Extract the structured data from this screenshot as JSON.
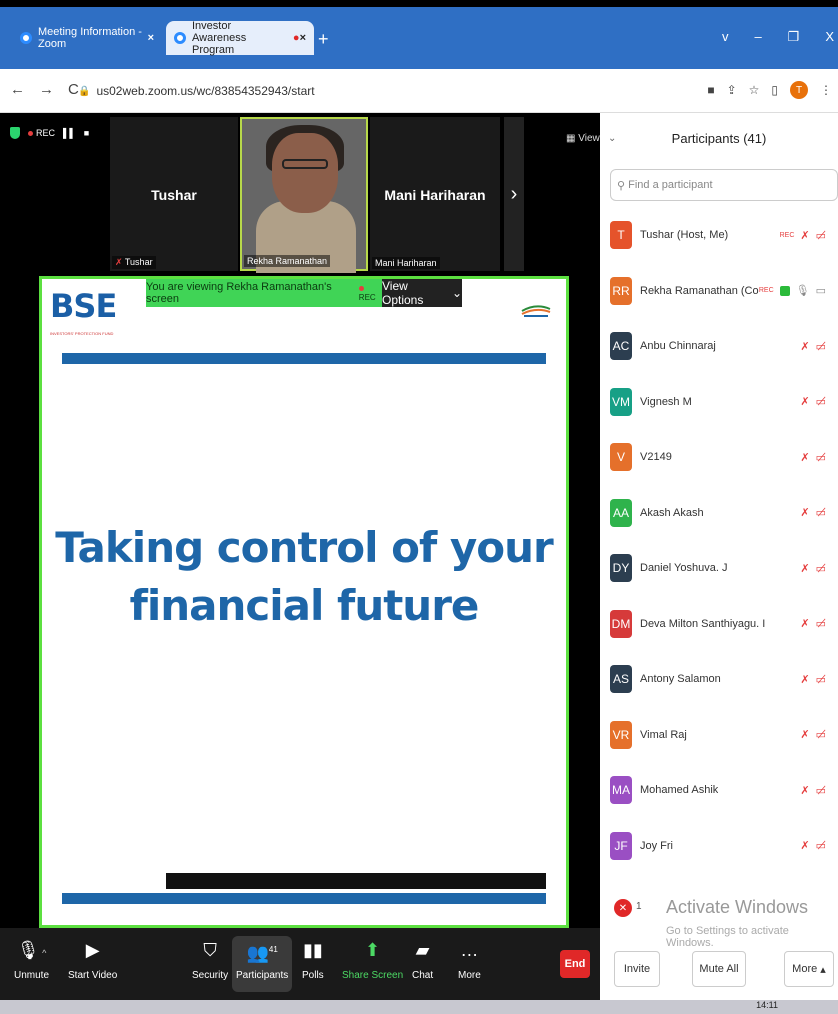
{
  "browser": {
    "tabs": [
      {
        "label": "Meeting Information - Zoom"
      },
      {
        "label": "Investor Awareness Program"
      }
    ],
    "url": "us02web.zoom.us/wc/83854352943/start",
    "profile_initial": "T"
  },
  "meeting": {
    "rec_label": "REC",
    "view_label": "View",
    "tiles": [
      {
        "name": "Tushar",
        "label": "Tushar"
      },
      {
        "name": "",
        "label": "Rekha Ramanathan"
      },
      {
        "name": "Mani Hariharan",
        "label": "Mani Hariharan"
      }
    ],
    "viewing_banner": "You are viewing Rekha Ramanathan's screen",
    "banner_rec": "REC",
    "view_options": "View Options",
    "slide": {
      "logo": "BSE",
      "logo_sub": "INVESTORS' PROTECTION FUND",
      "title_line1": "Taking control of your",
      "title_line2": "financial future"
    }
  },
  "toolbar": {
    "unmute": "Unmute",
    "start_video": "Start Video",
    "security": "Security",
    "participants": "Participants",
    "participants_count": "41",
    "polls": "Polls",
    "share_screen": "Share Screen",
    "chat": "Chat",
    "more": "More",
    "end": "End"
  },
  "panel": {
    "title": "Participants (41)",
    "search_placeholder": "Find a participant",
    "participants": [
      {
        "initials": "T",
        "name": "Tushar (Host, Me)",
        "color": "#e5532b",
        "rec": "REC"
      },
      {
        "initials": "RR",
        "name": "Rekha Ramanathan (Co-host)",
        "color": "#e5702b",
        "rec": "REC"
      },
      {
        "initials": "AC",
        "name": "Anbu Chinnaraj",
        "color": "#2c3e50"
      },
      {
        "initials": "VM",
        "name": "Vignesh M",
        "color": "#17a086"
      },
      {
        "initials": "V",
        "name": "V2149",
        "color": "#e5702b"
      },
      {
        "initials": "AA",
        "name": "Akash Akash",
        "color": "#2fb34c"
      },
      {
        "initials": "DY",
        "name": "Daniel Yoshuva. J",
        "color": "#2c3e50"
      },
      {
        "initials": "DM",
        "name": "Deva Milton Santhiyagu. I",
        "color": "#d63a3a"
      },
      {
        "initials": "AS",
        "name": "Antony Salamon",
        "color": "#2c3e50"
      },
      {
        "initials": "VR",
        "name": "Vimal Raj",
        "color": "#e5702b"
      },
      {
        "initials": "MA",
        "name": "Mohamed Ashik",
        "color": "#9a4fc3"
      },
      {
        "initials": "JF",
        "name": "Joy Fri",
        "color": "#9a4fc3"
      }
    ],
    "badge_count": "1",
    "activate_title": "Activate Windows",
    "activate_sub": "Go to Settings to activate Windows.",
    "invite": "Invite",
    "mute_all": "Mute All",
    "more": "More"
  },
  "taskbar": {
    "time": "14:11"
  }
}
